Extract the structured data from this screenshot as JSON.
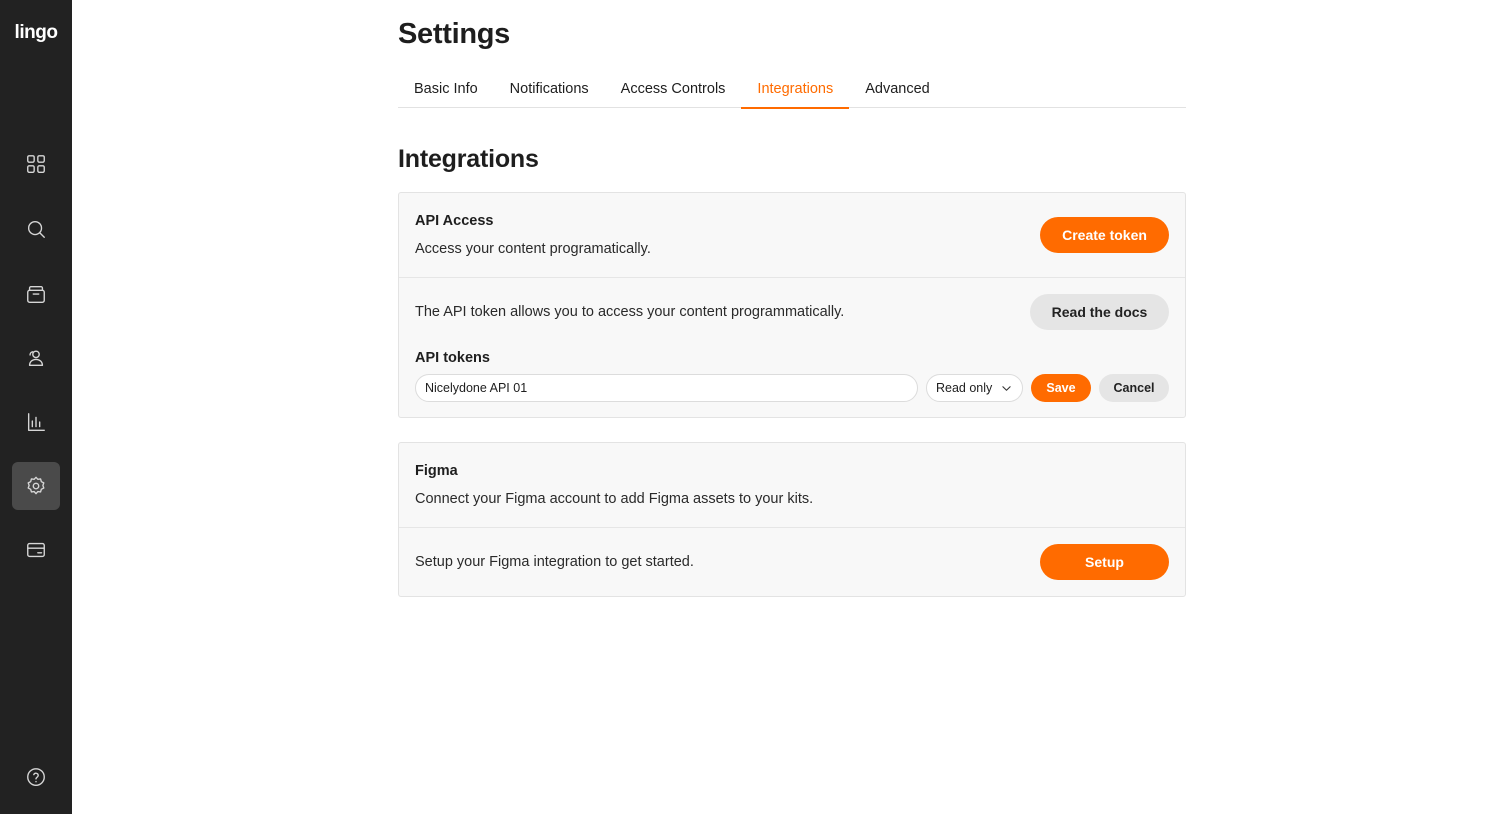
{
  "app": {
    "logo": "lingo"
  },
  "sidebar": {
    "items": [
      {
        "icon": "grid-icon"
      },
      {
        "icon": "search-icon"
      },
      {
        "icon": "archive-icon"
      },
      {
        "icon": "users-icon"
      },
      {
        "icon": "chart-icon"
      },
      {
        "icon": "gear-icon",
        "active": true
      },
      {
        "icon": "billing-icon"
      }
    ],
    "help_icon": "help-icon"
  },
  "page": {
    "title": "Settings"
  },
  "tabs": [
    {
      "label": "Basic Info"
    },
    {
      "label": "Notifications"
    },
    {
      "label": "Access Controls"
    },
    {
      "label": "Integrations",
      "active": true
    },
    {
      "label": "Advanced"
    }
  ],
  "section": {
    "title": "Integrations"
  },
  "api_card": {
    "title": "API Access",
    "description": "Access your content programatically.",
    "create_button": "Create token",
    "info_text": "The API token allows you to access your content programmatically.",
    "docs_button": "Read the docs",
    "tokens_heading": "API tokens",
    "token_name_value": "Nicelydone API 01",
    "permission_value": "Read only",
    "save_button": "Save",
    "cancel_button": "Cancel"
  },
  "figma_card": {
    "title": "Figma",
    "description": "Connect your Figma account to add Figma assets to your kits.",
    "setup_text": "Setup your Figma integration to get started.",
    "setup_button": "Setup"
  },
  "colors": {
    "accent": "#ff6b00",
    "sidebar": "#222222",
    "card_bg": "#f8f8f8"
  }
}
